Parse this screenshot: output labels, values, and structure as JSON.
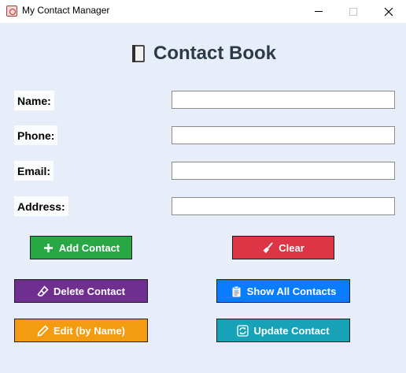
{
  "window": {
    "title": "My Contact Manager",
    "icon": "contact-manager-app-icon",
    "controls": [
      "minimize-icon",
      "maximize-icon",
      "close-icon"
    ]
  },
  "header": {
    "icon": "book-icon",
    "title": "Contact Book",
    "color": "#2d3a47"
  },
  "form": {
    "name_label": "Name:",
    "name_value": "",
    "phone_label": "Phone:",
    "phone_value": "",
    "email_label": "Email:",
    "email_value": "",
    "address_label": "Address:",
    "address_value": ""
  },
  "buttons": {
    "add": {
      "label": "Add Contact",
      "icon": "plus-icon",
      "color": "#28a745"
    },
    "clear": {
      "label": "Clear",
      "icon": "broom-icon",
      "color": "#dc3545"
    },
    "delete": {
      "label": "Delete Contact",
      "icon": "eraser-icon",
      "color": "#6f2f8f"
    },
    "show_all": {
      "label": "Show All Contacts",
      "icon": "clipboard-icon",
      "color": "#0a7cff"
    },
    "edit": {
      "label": "Edit (by Name)",
      "icon": "pencil-icon",
      "color": "#f39c12"
    },
    "update": {
      "label": "Update Contact",
      "icon": "refresh-icon",
      "color": "#17a2b8"
    }
  },
  "colors": {
    "background": "#e8eef9"
  }
}
